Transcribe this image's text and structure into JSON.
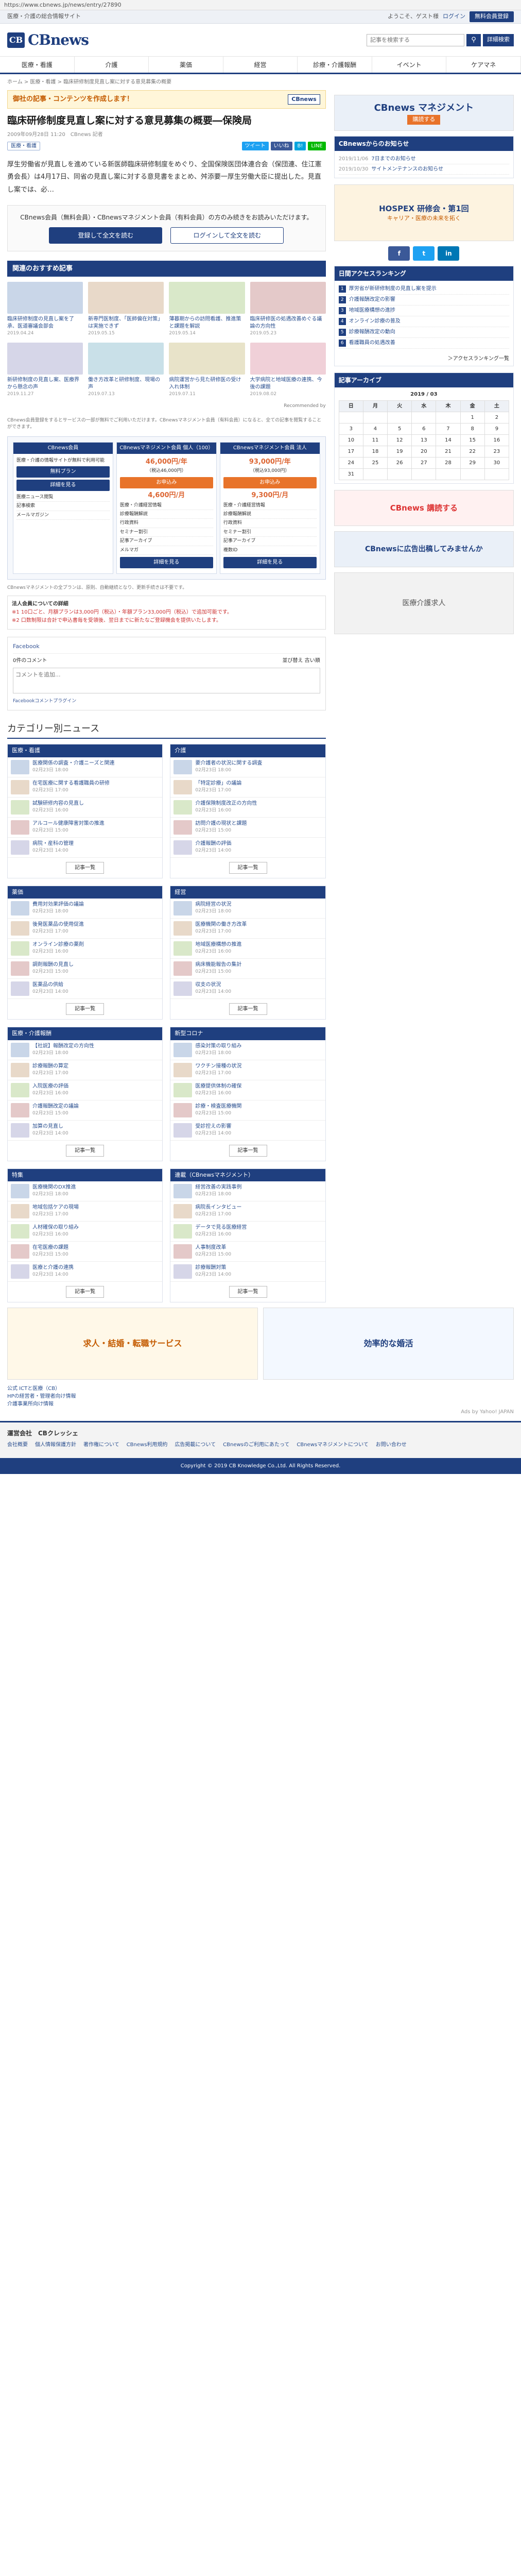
{
  "browser": {
    "url": "https://www.cbnews.jp/news/entry/27890"
  },
  "topstrip": {
    "left": "医療・介護の総合情報サイト",
    "welcome": "ようこそ、ゲスト様",
    "login": "ログイン",
    "register": "無料会員登録"
  },
  "header": {
    "logo_mark": "CB",
    "logo_text": "CBnews",
    "search_placeholder": "記事を検索する",
    "search_icon": "search-icon",
    "menu_button": "詳細検索"
  },
  "nav": [
    "医療・看護",
    "介護",
    "薬価",
    "経営",
    "診療・介護報酬",
    "イベント",
    "ケアマネ"
  ],
  "breadcrumb": "ホーム > 医療・看護 > 臨床研修制度見直し案に対する意見募集の概要",
  "promo": {
    "text": "御社の記事・コンテンツを作成します！",
    "brand": "CBnews"
  },
  "article": {
    "title": "臨床研修制度見直し案に対する意見募集の概要―保険局",
    "date": "2009年09月28日 11:20",
    "author": "CBnews 記者",
    "tag": "医療・看護",
    "share_labels": [
      "ツイート",
      "いいね",
      "B!",
      "LINE"
    ],
    "body": "厚生労働省が見直しを進めている新医師臨床研修制度をめぐり、全国保険医団体連合会（保団連、住江憲勇会長）は4月17日、同省の見直し案に対する意見書をまとめ、舛添要一厚生労働大臣に提出した。見直し案では、必…",
    "login_prompt": "CBnews会員（無料会員）・CBnewsマネジメント会員（有料会員）の方のみ続きをお読みいただけます。",
    "register_button": "登録して全文を読む",
    "login_button": "ログインして全文を読む"
  },
  "recommend": {
    "heading": "関連のおすすめ記事",
    "items": [
      {
        "title": "臨床研修制度の見直し案を了承、医道審議会部会",
        "date": "2019.04.24",
        "color": "#c9d6e8"
      },
      {
        "title": "新専門医制度、「医師偏在対策」は実施できず",
        "date": "2019.05.15",
        "color": "#e8d9c9"
      },
      {
        "title": "薄暮期からの訪問看護、推進策と課題を解説",
        "date": "2019.05.14",
        "color": "#d9e8c9"
      },
      {
        "title": "臨床研修医の処遇改善めぐる議論の方向性",
        "date": "2019.05.23",
        "color": "#e4c9c9"
      },
      {
        "title": "新研修制度の見直し案、医療界から懸念の声",
        "date": "2019.11.27",
        "color": "#d6d6e8"
      },
      {
        "title": "働き方改革と研修制度、現場の声",
        "date": "2019.07.13",
        "color": "#c9e0e8"
      },
      {
        "title": "病院運営から見た研修医の受け入れ体制",
        "date": "2019.07.11",
        "color": "#e8e3c9"
      },
      {
        "title": "大学病院と地域医療の連携、今後の課題",
        "date": "2019.08.02",
        "color": "#f0d0d8"
      }
    ],
    "note": "Recommended by"
  },
  "plans": {
    "intro": "CBnews会員登録をするとサービスの一部が無料でご利用いただけます。CBnewsマネジメント会員（有料会員）になると、全ての記事を閲覧することができます。",
    "free_label": "CBnews会員",
    "free_desc": "医療・介護の情報サイトが無料で利用可能",
    "free_btn1": "無料プラン",
    "free_btn2": "詳細を見る",
    "free_features": [
      "医療ニュース閲覧",
      "記事検索",
      "メールマガジン"
    ],
    "paid": [
      {
        "name": "CBnewsマネジメント会員 個人（100）",
        "price": "46,000円/年",
        "sub": "（税込46,000円）",
        "btn": "お申込み",
        "monthly": "4,600円/月",
        "features": [
          "医療・介護経営情報",
          "診療報酬解説",
          "行政資料",
          "セミナー割引",
          "記事アーカイブ",
          "メルマガ"
        ]
      },
      {
        "name": "CBnewsマネジメント会員 法人",
        "price": "93,000円/年",
        "sub": "（税込93,000円）",
        "btn": "お申込み",
        "monthly": "9,300円/月",
        "features": [
          "医療・介護経営情報",
          "診療報酬解説",
          "行政資料",
          "セミナー割引",
          "記事アーカイブ",
          "複数ID"
        ]
      }
    ],
    "detail_btn": "詳細を見る",
    "footnote": "CBnewsマネジメントの全プランは、原則、自動継続となり、更新手続きは不要です。",
    "corp_title": "法人会員についての詳細",
    "corp_lines": [
      "※1 10口ごと、月額プランは3,000円（税込）・年額プラン33,000円（税込）で追加可能です。",
      "※2 口数制限は合計で申込書毎を受領後、翌日までに新たなご登録機会を提供いたします。"
    ]
  },
  "comments": {
    "fb_label": "Facebook",
    "count": "0件のコメント",
    "sort": "並び替え",
    "sort_value": "古い順",
    "placeholder": "コメントを追加...",
    "plugin": "Facebookコメントプラグイン"
  },
  "categories": {
    "heading": "カテゴリー別ニュース",
    "boxes": [
      {
        "name": "医療・看護",
        "items": [
          {
            "t": "医療関係の調査・介護ニーズと関連",
            "d": "02月23日 18:00"
          },
          {
            "t": "在宅医療に関する看護職員の研修",
            "d": "02月23日 17:00"
          },
          {
            "t": "試験研修内容の見直し",
            "d": "02月23日 16:00"
          },
          {
            "t": "アルコール健康障害対策の推進",
            "d": "02月23日 15:00"
          },
          {
            "t": "病院・産科の管理",
            "d": "02月23日 14:00"
          }
        ]
      },
      {
        "name": "介護",
        "items": [
          {
            "t": "要介護者の状況に関する調査",
            "d": "02月23日 18:00"
          },
          {
            "t": "「特定診療」の議論",
            "d": "02月23日 17:00"
          },
          {
            "t": "介護保険制度改正の方向性",
            "d": "02月23日 16:00"
          },
          {
            "t": "訪問介護の現状と課題",
            "d": "02月23日 15:00"
          },
          {
            "t": "介護報酬の評価",
            "d": "02月23日 14:00"
          }
        ]
      },
      {
        "name": "薬価",
        "items": [
          {
            "t": "費用対効果評価の議論",
            "d": "02月23日 18:00"
          },
          {
            "t": "後発医薬品の使用促進",
            "d": "02月23日 17:00"
          },
          {
            "t": "オンライン診療の薬剤",
            "d": "02月23日 16:00"
          },
          {
            "t": "調剤報酬の見直し",
            "d": "02月23日 15:00"
          },
          {
            "t": "医薬品の供給",
            "d": "02月23日 14:00"
          }
        ]
      },
      {
        "name": "経営",
        "items": [
          {
            "t": "病院経営の状況",
            "d": "02月23日 18:00"
          },
          {
            "t": "医療機関の働き方改革",
            "d": "02月23日 17:00"
          },
          {
            "t": "地域医療構想の推進",
            "d": "02月23日 16:00"
          },
          {
            "t": "病床機能報告の集計",
            "d": "02月23日 15:00"
          },
          {
            "t": "収支の状況",
            "d": "02月23日 14:00"
          }
        ]
      },
      {
        "name": "医療・介護報酬",
        "items": [
          {
            "t": "【社説】報酬改定の方向性",
            "d": "02月23日 18:00"
          },
          {
            "t": "診療報酬の算定",
            "d": "02月23日 17:00"
          },
          {
            "t": "入院医療の評価",
            "d": "02月23日 16:00"
          },
          {
            "t": "介護報酬改定の議論",
            "d": "02月23日 15:00"
          },
          {
            "t": "加算の見直し",
            "d": "02月23日 14:00"
          }
        ]
      },
      {
        "name": "新型コロナ",
        "items": [
          {
            "t": "感染対策の取り組み",
            "d": "02月23日 18:00"
          },
          {
            "t": "ワクチン接種の状況",
            "d": "02月23日 17:00"
          },
          {
            "t": "医療提供体制の確保",
            "d": "02月23日 16:00"
          },
          {
            "t": "診療・検査医療機関",
            "d": "02月23日 15:00"
          },
          {
            "t": "受診控えの影響",
            "d": "02月23日 14:00"
          }
        ]
      },
      {
        "name": "特集",
        "items": [
          {
            "t": "医療機関のDX推進",
            "d": "02月23日 18:00"
          },
          {
            "t": "地域包括ケアの現場",
            "d": "02月23日 17:00"
          },
          {
            "t": "人材確保の取り組み",
            "d": "02月23日 16:00"
          },
          {
            "t": "在宅医療の課題",
            "d": "02月23日 15:00"
          },
          {
            "t": "医療と介護の連携",
            "d": "02月23日 14:00"
          }
        ]
      },
      {
        "name": "連載（CBnewsマネジメント）",
        "items": [
          {
            "t": "経営改善の実践事例",
            "d": "02月23日 18:00"
          },
          {
            "t": "病院長インタビュー",
            "d": "02月23日 17:00"
          },
          {
            "t": "データで見る医療経営",
            "d": "02月23日 16:00"
          },
          {
            "t": "人事制度改革",
            "d": "02月23日 15:00"
          },
          {
            "t": "診療報酬対策",
            "d": "02月23日 14:00"
          }
        ]
      }
    ],
    "more": "記事一覧"
  },
  "sidebar": {
    "ad_top": "CBnews マネジメント",
    "ad_top_sub": "購読する",
    "notice_heading": "CBnewsからのお知らせ",
    "notices": [
      {
        "d": "2019/11/06",
        "t": "7日までのお知らせ"
      },
      {
        "d": "2019/10/30",
        "t": "サイトメンテナンスのお知らせ"
      }
    ],
    "ad_mid": "HOSPEX 研修会・第1回",
    "ad_mid2": "キャリア・医療の未来を拓く",
    "ranking_heading": "日間アクセスランキング",
    "ranking": [
      "厚労省が新研修制度の見直し案を提示",
      "介護報酬改定の影響",
      "地域医療構想の進捗",
      "オンライン診療の普及",
      "診療報酬改定の動向",
      "看護職員の処遇改善"
    ],
    "ranking_more": "＞アクセスランキング一覧",
    "archive_heading": "記事アーカイブ",
    "archive_month": "2019 / 03",
    "weekdays": [
      "日",
      "月",
      "火",
      "水",
      "木",
      "金",
      "土"
    ],
    "weeks": [
      [
        "",
        "",
        "",
        "",
        "",
        "1",
        "2"
      ],
      [
        "3",
        "4",
        "5",
        "6",
        "7",
        "8",
        "9"
      ],
      [
        "10",
        "11",
        "12",
        "13",
        "14",
        "15",
        "16"
      ],
      [
        "17",
        "18",
        "19",
        "20",
        "21",
        "22",
        "23"
      ],
      [
        "24",
        "25",
        "26",
        "27",
        "28",
        "29",
        "30"
      ],
      [
        "31",
        "",
        "",
        "",
        "",
        "",
        ""
      ]
    ],
    "ad_low1": "CBnews 講読する",
    "ad_low2": "CBnewsに広告出稿してみませんか",
    "ad_low3": "医療介護求人",
    "social": [
      "f",
      "t",
      "in"
    ]
  },
  "bottom_ads": [
    "求人・結婚・転職サービス",
    "効率的な婚活"
  ],
  "bottom_links": [
    {
      "t": "公式 ICTと医療（CB）"
    },
    {
      "t": "HPの経営者・管理者向け情報"
    },
    {
      "t": "介護事業所向け情報"
    }
  ],
  "ad_credit": "Ads by Yahoo! JAPAN",
  "footer": {
    "company": "運営会社　CBクレッシェ",
    "links": [
      "会社概要",
      "個人情報保護方針",
      "著作権について",
      "CBnews利用規約",
      "広告掲載について",
      "CBnewsのご利用にあたって",
      "CBnewsマネジメントについて",
      "お問い合わせ"
    ],
    "copyright": "Copyright © 2019 CB Knowledge Co.,Ltd. All Rights Reserved."
  }
}
